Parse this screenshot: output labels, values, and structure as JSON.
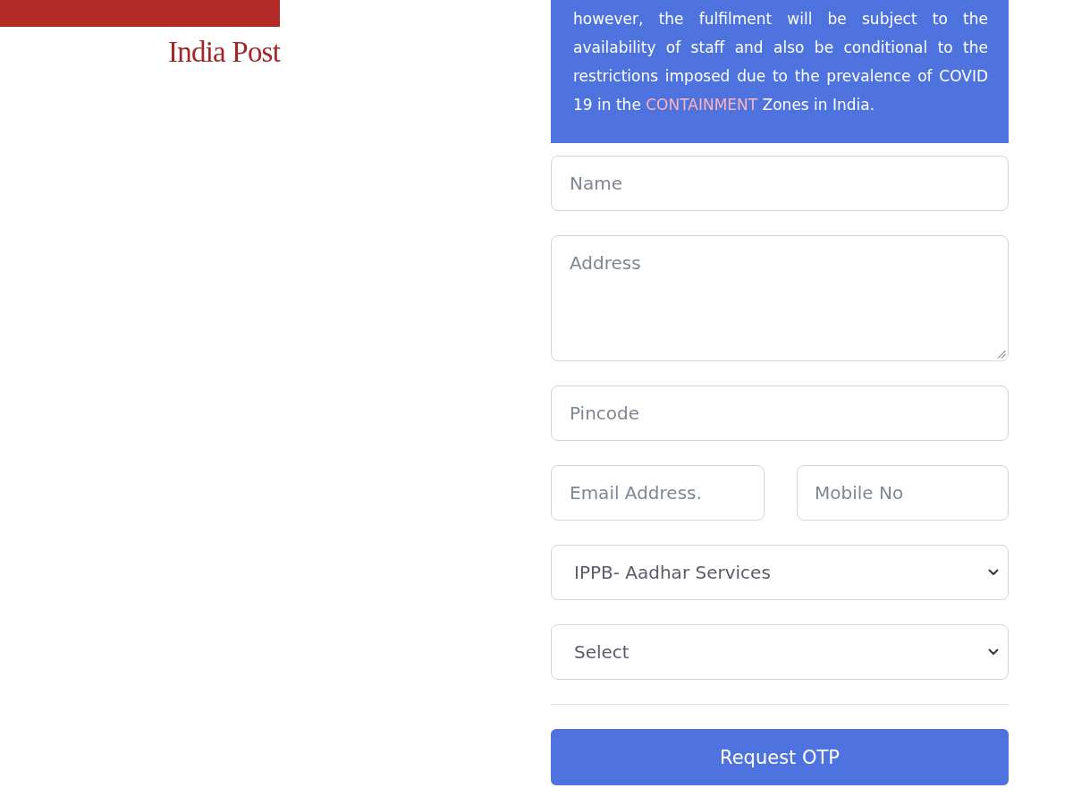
{
  "logo": {
    "text": "India Post"
  },
  "notice": {
    "segments": [
      {
        "text": "however, the fulfilment will be subject to the availability of staff and also be conditional to the restrictions imposed due to the prevalence of COVID 19 in the ",
        "highlight": false
      },
      {
        "text": "CONTAINMENT",
        "highlight": true
      },
      {
        "text": " Zones in India.",
        "highlight": false
      }
    ]
  },
  "form": {
    "rows": [
      {
        "kind": "input",
        "placeholder": "Name"
      },
      {
        "kind": "textarea",
        "placeholder": "Address"
      },
      {
        "kind": "input",
        "placeholder": "Pincode"
      },
      {
        "kind": "pair",
        "fields": [
          {
            "placeholder": "Email Address."
          },
          {
            "placeholder": "Mobile No"
          }
        ]
      },
      {
        "kind": "select",
        "value": "IPPB- Aadhar Services"
      },
      {
        "kind": "select",
        "value": "Select"
      }
    ],
    "submit_button": "Request OTP"
  }
}
